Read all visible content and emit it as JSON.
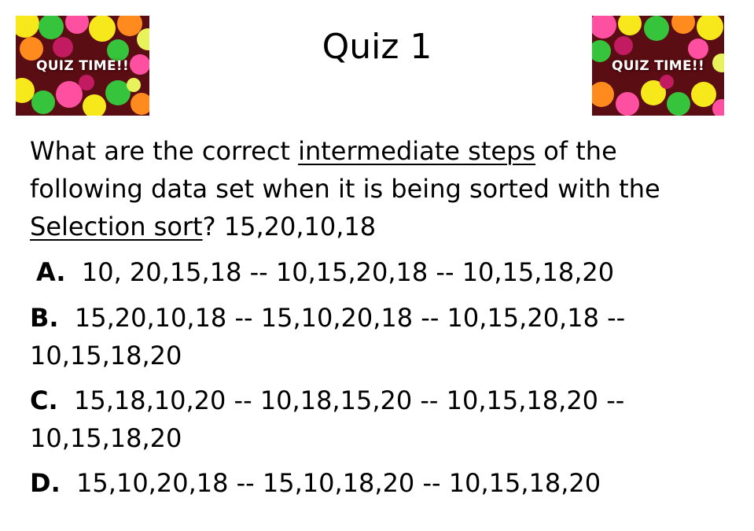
{
  "slide": {
    "title": "Quiz 1",
    "badge_text": "QUIZ TIME!!",
    "question": {
      "part1": "What are the correct ",
      "underlined1": "intermediate steps",
      "part2": " of the following data set when it is being sorted with the ",
      "underlined2": "Selection sort",
      "part3": "? 15,20,10,18"
    },
    "options": [
      {
        "letter": "A.",
        "text": "10, 20,15,18 -- 10,15,20,18 -- 10,15,18,20"
      },
      {
        "letter": "B.",
        "text": "15,20,10,18 -- 15,10,20,18 -- 10,15,20,18 -- 10,15,18,20"
      },
      {
        "letter": "C.",
        "text": "15,18,10,20 -- 10,18,15,20 -- 10,15,18,20 -- 10,15,18,20"
      },
      {
        "letter": "D.",
        "text": "15,10,20,18 -- 15,10,18,20 -- 10,15,18,20"
      }
    ]
  },
  "colors": {
    "badge_background": "#5a0d12",
    "bokeh": [
      "#f7e81c",
      "#ff4fa0",
      "#35c43b",
      "#ff8a1e",
      "#c21b62",
      "#e8f25a"
    ]
  }
}
